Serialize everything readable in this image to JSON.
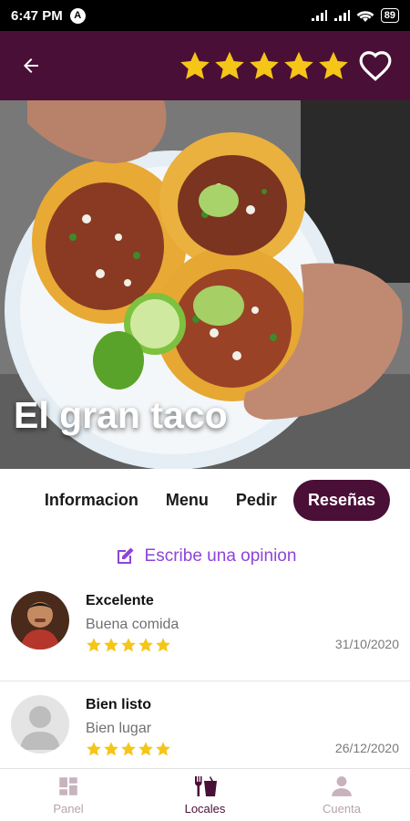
{
  "status_bar": {
    "time": "6:47 PM",
    "app_icon": "A",
    "battery": "89"
  },
  "app_bar": {
    "back_icon": "arrow-left-icon",
    "rating": 5,
    "favorite_icon": "heart-outline-icon",
    "colors": {
      "background": "#4a0f36",
      "star": "#f5c518"
    }
  },
  "restaurant": {
    "name": "El gran taco"
  },
  "tabs": [
    {
      "label": "Informacion",
      "active": false
    },
    {
      "label": "Menu",
      "active": false
    },
    {
      "label": "Pedir",
      "active": false
    },
    {
      "label": "Reseñas",
      "active": true
    }
  ],
  "write_review": {
    "label": "Escribe una opinion",
    "icon": "edit-icon",
    "color": "#8e44d8"
  },
  "reviews": [
    {
      "title": "Excelente",
      "comment": "Buena comida",
      "rating": 5,
      "date": "31/10/2020",
      "avatar": "user-photo"
    },
    {
      "title": "Bien listo",
      "comment": "Bien lugar",
      "rating": 5,
      "date": "26/12/2020",
      "avatar": "default-avatar-icon"
    }
  ],
  "bottom_nav": [
    {
      "label": "Panel",
      "icon": "dashboard-icon",
      "active": false
    },
    {
      "label": "Locales",
      "icon": "restaurant-icon",
      "active": true
    },
    {
      "label": "Cuenta",
      "icon": "account-icon",
      "active": false
    }
  ]
}
